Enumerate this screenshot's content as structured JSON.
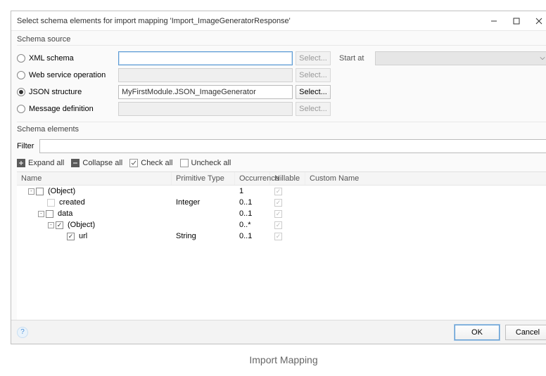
{
  "window": {
    "title": "Select schema elements for import mapping 'Import_ImageGeneratorResponse'"
  },
  "schemaSource": {
    "label": "Schema source",
    "options": {
      "xml": {
        "label": "XML schema",
        "value": "",
        "select": "Select...",
        "enabled": false
      },
      "ws": {
        "label": "Web service operation",
        "value": "",
        "select": "Select...",
        "enabled": false
      },
      "json": {
        "label": "JSON structure",
        "value": "MyFirstModule.JSON_ImageGenerator",
        "select": "Select...",
        "enabled": true
      },
      "msg": {
        "label": "Message definition",
        "value": "",
        "select": "Select...",
        "enabled": false
      }
    },
    "selected": "json",
    "startAt": {
      "label": "Start at",
      "value": ""
    }
  },
  "schemaElements": {
    "label": "Schema elements",
    "filterLabel": "Filter",
    "toolbar": {
      "expand": "Expand all",
      "collapse": "Collapse all",
      "check": "Check all",
      "uncheck": "Uncheck all"
    },
    "columns": {
      "name": "Name",
      "ptype": "Primitive Type",
      "occ": "Occurrence",
      "nill": "Nillable",
      "custom": "Custom Name"
    },
    "rows": [
      {
        "indent": 0,
        "expando": "-",
        "checked": false,
        "name": "(Object)",
        "ptype": "",
        "occ": "1",
        "nill": true
      },
      {
        "indent": 1,
        "expando": "",
        "checked": null,
        "name": "created",
        "ptype": "Integer",
        "occ": "0..1",
        "nill": true
      },
      {
        "indent": 1,
        "expando": "-",
        "checked": false,
        "name": "data",
        "ptype": "",
        "occ": "0..1",
        "nill": true
      },
      {
        "indent": 2,
        "expando": "-",
        "checked": true,
        "name": "(Object)",
        "ptype": "",
        "occ": "0..*",
        "nill": true
      },
      {
        "indent": 3,
        "expando": "",
        "checked": true,
        "name": "url",
        "ptype": "String",
        "occ": "0..1",
        "nill": true
      }
    ]
  },
  "footer": {
    "ok": "OK",
    "cancel": "Cancel"
  },
  "caption": "Import Mapping"
}
